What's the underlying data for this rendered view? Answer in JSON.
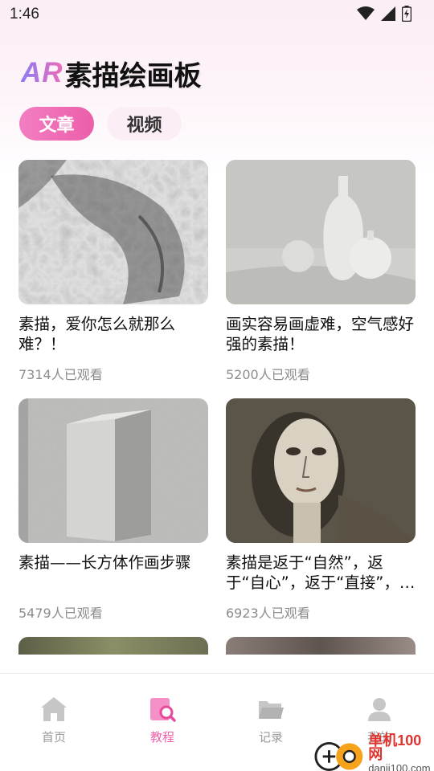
{
  "status_bar": {
    "time": "1:46",
    "icons": [
      "wifi-icon",
      "cell-signal-icon",
      "battery-charging-icon"
    ]
  },
  "header": {
    "logo_ar": "AR",
    "logo_text": "素描绘画板"
  },
  "tabs": [
    {
      "label": "文章",
      "active": true
    },
    {
      "label": "视频",
      "active": false
    }
  ],
  "articles": [
    {
      "title": "素描，爱你怎么就那么难？！",
      "views": "7314人已观看"
    },
    {
      "title": "画实容易画虚难，空气感好强的素描！",
      "views": "5200人已观看"
    },
    {
      "title": "素描——长方体作画步骤",
      "views": "5479人已观看"
    },
    {
      "title": "素描是返于“自然”，返于“自心”，返于“直接”，返于“自我”",
      "views": "6923人已观看"
    }
  ],
  "bottom_nav": [
    {
      "label": "首页",
      "icon": "home-icon",
      "active": false
    },
    {
      "label": "教程",
      "icon": "tutorial-search-icon",
      "active": true
    },
    {
      "label": "记录",
      "icon": "folder-icon",
      "active": false
    },
    {
      "label": "我的",
      "icon": "profile-icon",
      "active": false
    }
  ],
  "watermark": {
    "title": "单机100网",
    "url": "danji100.com"
  },
  "colors": {
    "accent": "#ef5fa8",
    "inactive_text": "#9a9a9a",
    "views_text": "#8c8c8c"
  }
}
